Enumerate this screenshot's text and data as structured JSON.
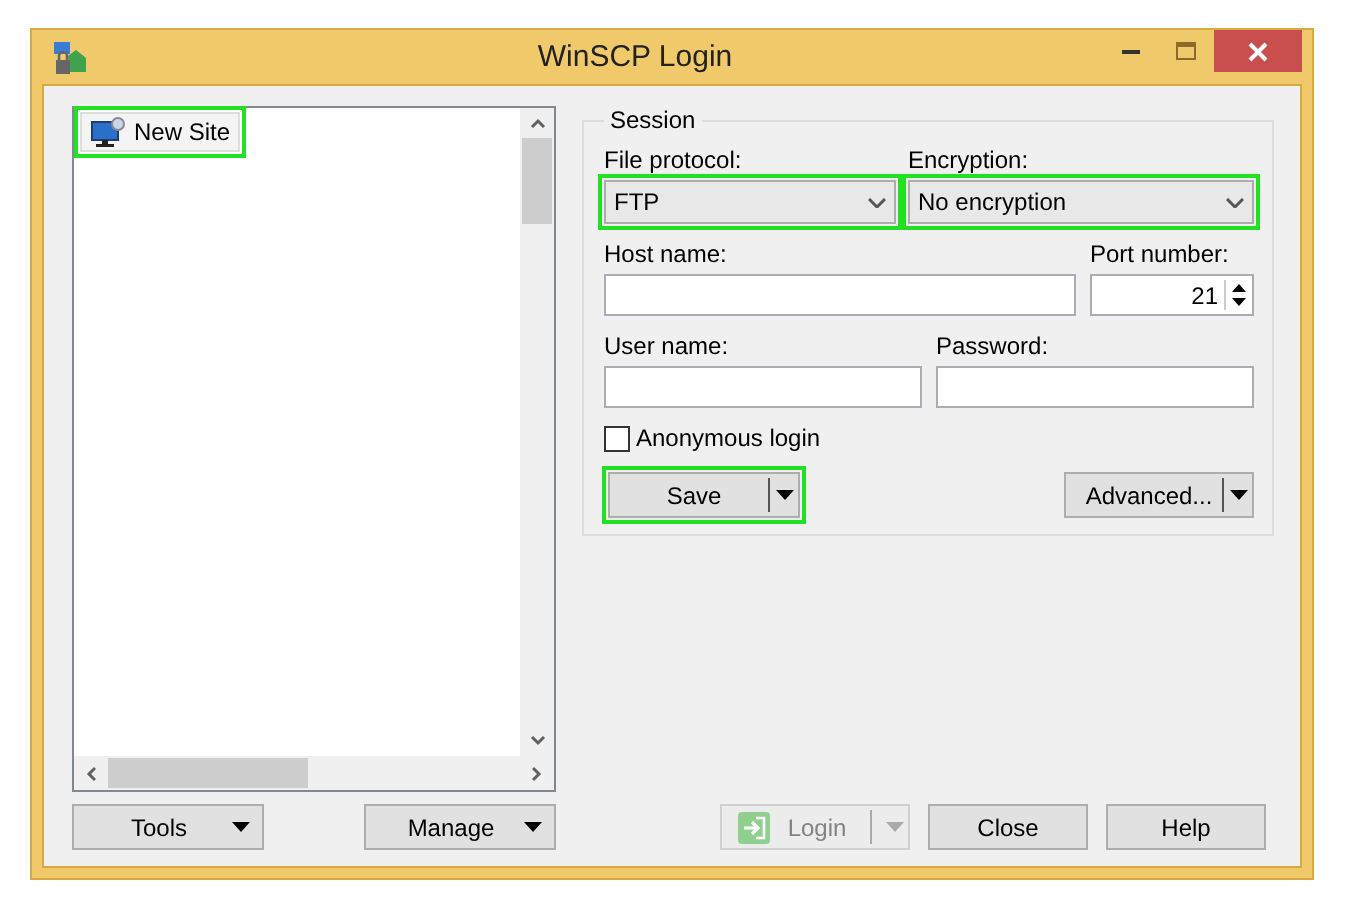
{
  "window": {
    "title": "WinSCP Login"
  },
  "sites": [
    {
      "label": "New Site",
      "selected": false,
      "highlighted": true
    }
  ],
  "left_buttons": [
    "Tools",
    "Manage"
  ],
  "session": {
    "title": "Session",
    "file_protocol": {
      "label": "File protocol:",
      "value": "FTP",
      "highlighted": true
    },
    "encryption": {
      "label": "Encryption:",
      "value": "No encryption",
      "highlighted": true
    },
    "host_name": {
      "label": "Host name:"
    },
    "port_number": {
      "label": "Port number:",
      "value": "21"
    },
    "user_name": {
      "label": "User name:"
    },
    "password": {
      "label": "Password:"
    },
    "anonymous_login": {
      "label": "Anonymous login",
      "checked": false
    },
    "save_button": {
      "label": "Save",
      "highlighted": true
    },
    "advanced_button": {
      "label": "Advanced..."
    }
  },
  "bottom_buttons": [
    {
      "kind": "login",
      "label": "Login",
      "disabled": true
    },
    {
      "kind": "plain",
      "label": "Close",
      "disabled": false
    },
    {
      "kind": "plain",
      "label": "Help",
      "disabled": false
    }
  ]
}
